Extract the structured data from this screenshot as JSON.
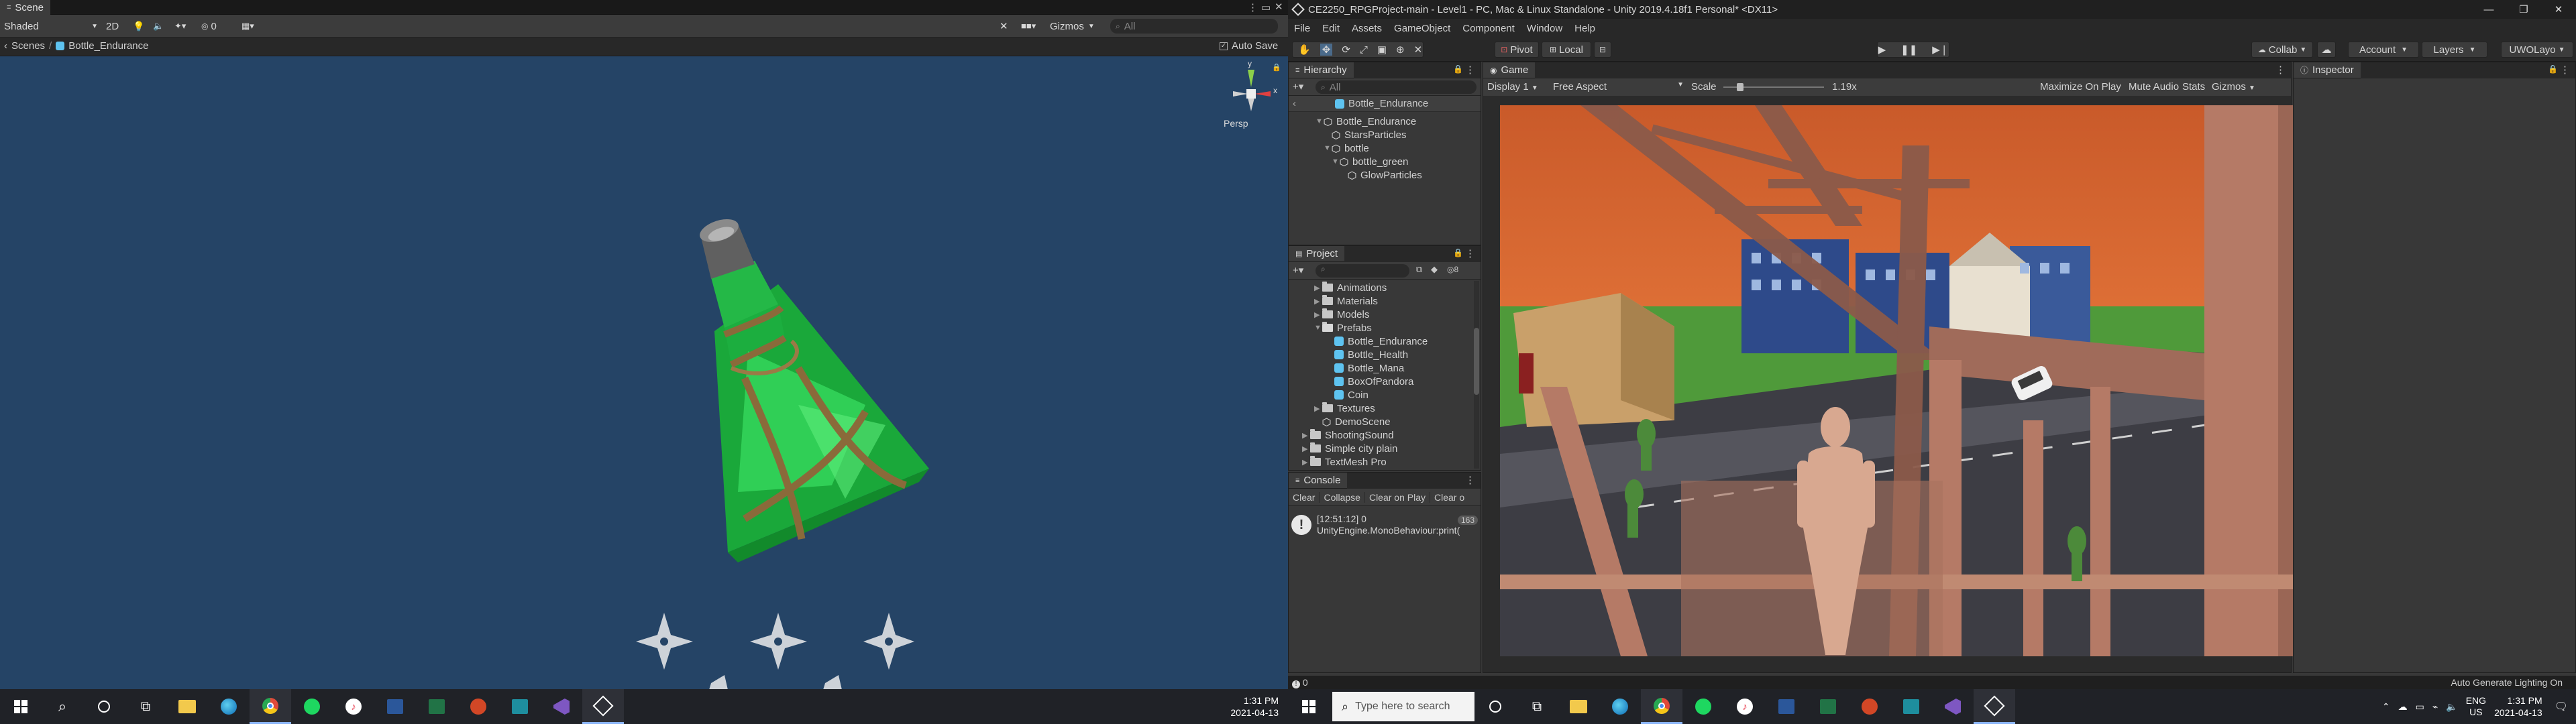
{
  "left": {
    "scene_tab": "Scene",
    "draw_mode": "Shaded",
    "mode_2d": "2D",
    "gizmos_count": "0",
    "gizmos_label": "Gizmos",
    "search_placeholder": "All",
    "crumb_scenes": "Scenes",
    "crumb_prefab": "Bottle_Endurance",
    "auto_save": "Auto Save",
    "persp": "Persp",
    "gizmo_y": "y",
    "gizmo_x": "x",
    "clock_time": "1:31 PM",
    "clock_date": "2021-04-13"
  },
  "right": {
    "window_title": "CE2250_RPGProject-main - Level1 - PC, Mac & Linux Standalone - Unity 2019.4.18f1 Personal* <DX11>",
    "menu": [
      "File",
      "Edit",
      "Assets",
      "GameObject",
      "Component",
      "Window",
      "Help"
    ],
    "pivot": "Pivot",
    "local": "Local",
    "collab": "Collab",
    "account": "Account",
    "layers": "Layers",
    "layout": "UWOLayo",
    "hierarchy": {
      "tab": "Hierarchy",
      "search_placeholder": "All",
      "root": "Bottle_Endurance",
      "items": [
        {
          "label": "Bottle_Endurance"
        },
        {
          "label": "StarsParticles"
        },
        {
          "label": "bottle"
        },
        {
          "label": "bottle_green"
        },
        {
          "label": "GlowParticles"
        }
      ]
    },
    "project": {
      "tab": "Project",
      "badge": "8",
      "items": [
        {
          "label": "Animations"
        },
        {
          "label": "Materials"
        },
        {
          "label": "Models"
        },
        {
          "label": "Prefabs"
        },
        {
          "label": "Bottle_Endurance"
        },
        {
          "label": "Bottle_Health"
        },
        {
          "label": "Bottle_Mana"
        },
        {
          "label": "BoxOfPandora"
        },
        {
          "label": "Coin"
        },
        {
          "label": "Textures"
        },
        {
          "label": "DemoScene"
        },
        {
          "label": "ShootingSound"
        },
        {
          "label": "Simple city plain"
        },
        {
          "label": "TextMesh Pro"
        }
      ]
    },
    "console": {
      "tab": "Console",
      "clear": "Clear",
      "collapse": "Collapse",
      "clear_on_play": "Clear on Play",
      "clear_on_build": "Clear o",
      "log_line1": "[12:51:12] 0",
      "log_line2": "UnityEngine.MonoBehaviour:print(",
      "log_count": "163"
    },
    "game": {
      "tab": "Game",
      "display": "Display 1",
      "aspect": "Free Aspect",
      "scale_label": "Scale",
      "scale_value": "1.19x",
      "maximize": "Maximize On Play",
      "mute": "Mute Audio",
      "stats": "Stats",
      "gizmos": "Gizmos"
    },
    "inspector_tab": "Inspector",
    "status_count": "0",
    "status_text": "Auto Generate Lighting On",
    "search_placeholder": "Type here to search",
    "lang_top": "ENG",
    "lang_bottom": "US",
    "clock_time": "1:31 PM",
    "clock_date": "2021-04-13"
  }
}
